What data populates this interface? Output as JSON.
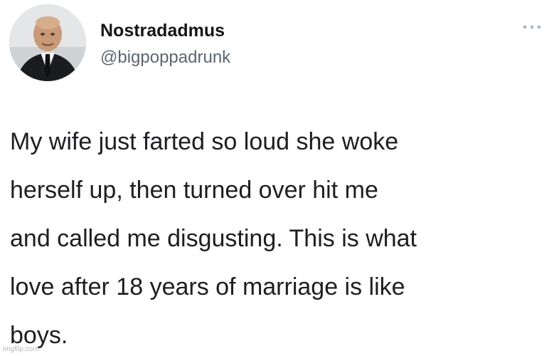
{
  "tweet": {
    "author": {
      "name": "Nostradadmus",
      "handle": "@bigpoppadrunk"
    },
    "more_icon": "more-horizontal-icon",
    "text": "My wife just farted so loud she woke\nherself up, then turned over hit me\nand called me disgusting.  This is what\nlove after 18 years of marriage is like\nboys."
  },
  "watermark": "imgflip.com",
  "colors": {
    "name": "#14171a",
    "handle": "#5b6670",
    "body_text": "#1c1e21",
    "icon": "#aab8c2"
  }
}
